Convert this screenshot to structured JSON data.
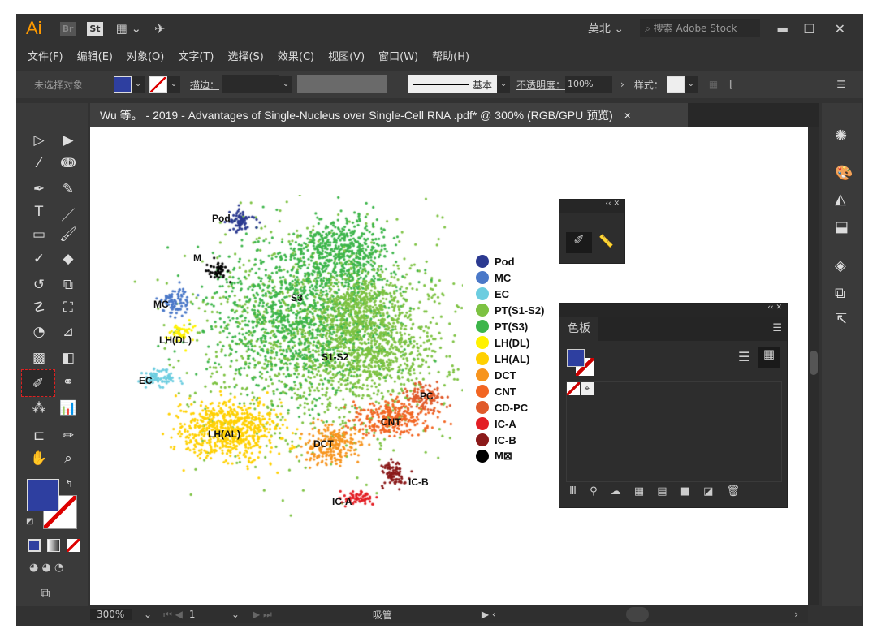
{
  "app": {
    "logo": "Ai",
    "bridge": "Br",
    "stock": "St",
    "workspace": "莫北",
    "search_placeholder": "搜索 Adobe Stock"
  },
  "menu": [
    "文件(F)",
    "编辑(E)",
    "对象(O)",
    "文字(T)",
    "选择(S)",
    "效果(C)",
    "视图(V)",
    "窗口(W)",
    "帮助(H)"
  ],
  "control": {
    "selection": "未选择对象",
    "stroke_label": "描边：",
    "stroke_style": "基本",
    "opacity_label": "不透明度：",
    "opacity": "100%",
    "style_label": "样式：",
    "fill_color": "#2e3fa0"
  },
  "document": {
    "tab_title": "Wu 等。 - 2019 - Advantages of Single-Nucleus over Single-Cell RNA .pdf* @ 300% (RGB/GPU 预览)",
    "close": "×"
  },
  "status": {
    "zoom": "300%",
    "page": "1",
    "tool": "吸管"
  },
  "swatches_panel": {
    "title": "色板"
  },
  "figure": {
    "cluster_labels": [
      "Pod",
      "M",
      "MC",
      "LH(DL)",
      "EC",
      "S3",
      "S1-S2",
      "PC",
      "CNT",
      "LH(AL)",
      "DCT",
      "IC-B",
      "IC-A"
    ],
    "legend": [
      {
        "label": "Pod",
        "color": "#2b3990"
      },
      {
        "label": "MC",
        "color": "#4a78c8"
      },
      {
        "label": "EC",
        "color": "#6ccde0"
      },
      {
        "label": "PT(S1-S2)",
        "color": "#7dc242"
      },
      {
        "label": "PT(S3)",
        "color": "#3cb54a"
      },
      {
        "label": "LH(DL)",
        "color": "#fff200"
      },
      {
        "label": "LH(AL)",
        "color": "#ffd000"
      },
      {
        "label": "DCT",
        "color": "#f7941d"
      },
      {
        "label": "CNT",
        "color": "#f26522"
      },
      {
        "label": "CD-PC",
        "color": "#e05a2b"
      },
      {
        "label": "IC-A",
        "color": "#e31e24"
      },
      {
        "label": "IC-B",
        "color": "#8b1a1a"
      },
      {
        "label": "M⊠",
        "color": "#000000"
      }
    ]
  }
}
